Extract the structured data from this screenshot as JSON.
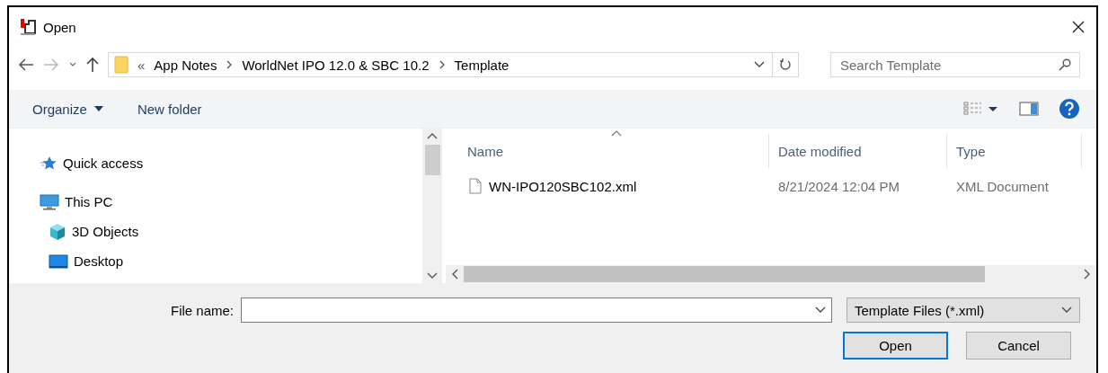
{
  "window": {
    "title": "Open"
  },
  "address": {
    "overflow": "«",
    "path": [
      "App Notes",
      "WorldNet IPO 12.0 & SBC 10.2",
      "Template"
    ]
  },
  "search": {
    "placeholder": "Search Template"
  },
  "toolbar": {
    "organize": "Organize",
    "new_folder": "New folder"
  },
  "navigation": [
    {
      "label": "Quick access"
    },
    {
      "label": "This PC",
      "children": [
        {
          "label": "3D Objects"
        },
        {
          "label": "Desktop"
        }
      ]
    }
  ],
  "file_list": {
    "columns": [
      "Name",
      "Date modified",
      "Type"
    ],
    "rows": [
      {
        "name": "WN-IPO120SBC102.xml",
        "date": "8/21/2024 12:04 PM",
        "type": "XML Document"
      }
    ]
  },
  "file_name": {
    "label": "File name:"
  },
  "filter": {
    "value": "Template Files (*.xml)"
  },
  "buttons": [
    {
      "label": "Open",
      "default": true
    },
    {
      "label": "Cancel",
      "default": false
    }
  ]
}
